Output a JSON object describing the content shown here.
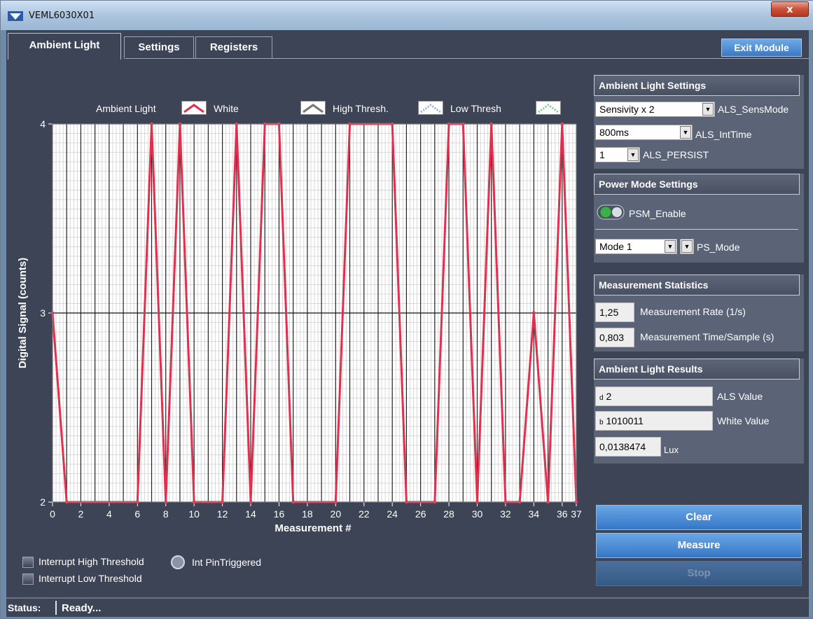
{
  "window": {
    "title": "VEML6030X01",
    "close_glyph": "x"
  },
  "tabs": [
    "Ambient Light",
    "Settings",
    "Registers"
  ],
  "exit_label": "Exit Module",
  "chart_legend": {
    "prefix": "Ambient Light",
    "items": [
      "White",
      "High Thresh.",
      "Low Thresh"
    ]
  },
  "chart_data": {
    "type": "line",
    "xlabel": "Measurement #",
    "ylabel": "Digital Signal  (counts)",
    "xlim": [
      0,
      37
    ],
    "ylim": [
      2,
      4
    ],
    "xticks": [
      0,
      2,
      4,
      6,
      8,
      10,
      12,
      14,
      16,
      18,
      20,
      22,
      24,
      26,
      28,
      30,
      32,
      34,
      36,
      37
    ],
    "yticks": [
      2,
      3,
      4
    ],
    "grid": true,
    "series": [
      {
        "name": "White",
        "color": "#e0304e",
        "x": [
          0,
          1,
          6,
          7,
          8,
          9,
          10,
          12,
          13,
          14,
          15,
          16,
          17,
          20,
          21,
          24,
          25,
          27,
          28,
          29,
          30,
          31,
          32,
          33,
          34,
          35,
          36,
          37
        ],
        "y": [
          3,
          2,
          2,
          4,
          2,
          4,
          2,
          2,
          4,
          2,
          4,
          4,
          2,
          2,
          4,
          4,
          2,
          2,
          4,
          4,
          2,
          4,
          2,
          2,
          3,
          2,
          4,
          2
        ]
      }
    ]
  },
  "checkboxes": [
    "Interrupt High Threshold",
    "Interrupt Low Threshold"
  ],
  "int_pin_label": "Int PinTriggered",
  "als_settings": {
    "header": "Ambient Light Settings",
    "sens_value": "Sensivity x 2",
    "sens_label": "ALS_SensMode",
    "int_value": "800ms",
    "int_label": "ALS_IntTime",
    "persist_value": "1",
    "persist_label": "ALS_PERSIST"
  },
  "power_mode": {
    "header": "Power Mode Settings",
    "psm_label": "PSM_Enable",
    "mode_value": "Mode 1",
    "mode_label": "PS_Mode"
  },
  "stats": {
    "header": "Measurement Statistics",
    "rate_value": "1,25",
    "rate_label": "Measurement Rate (1/s)",
    "time_value": "0,803",
    "time_label": "Measurement Time/Sample (s)"
  },
  "results": {
    "header": "Ambient Light Results",
    "als_prefix": "d",
    "als_value": "2",
    "als_label": "ALS Value",
    "white_prefix": "b",
    "white_value": "1010011",
    "white_label": "White Value",
    "lux_value": "0,0138474",
    "lux_label": "Lux"
  },
  "buttons": {
    "clear": "Clear",
    "measure": "Measure",
    "stop": "Stop"
  },
  "status": {
    "label": "Status:",
    "value": "Ready..."
  }
}
